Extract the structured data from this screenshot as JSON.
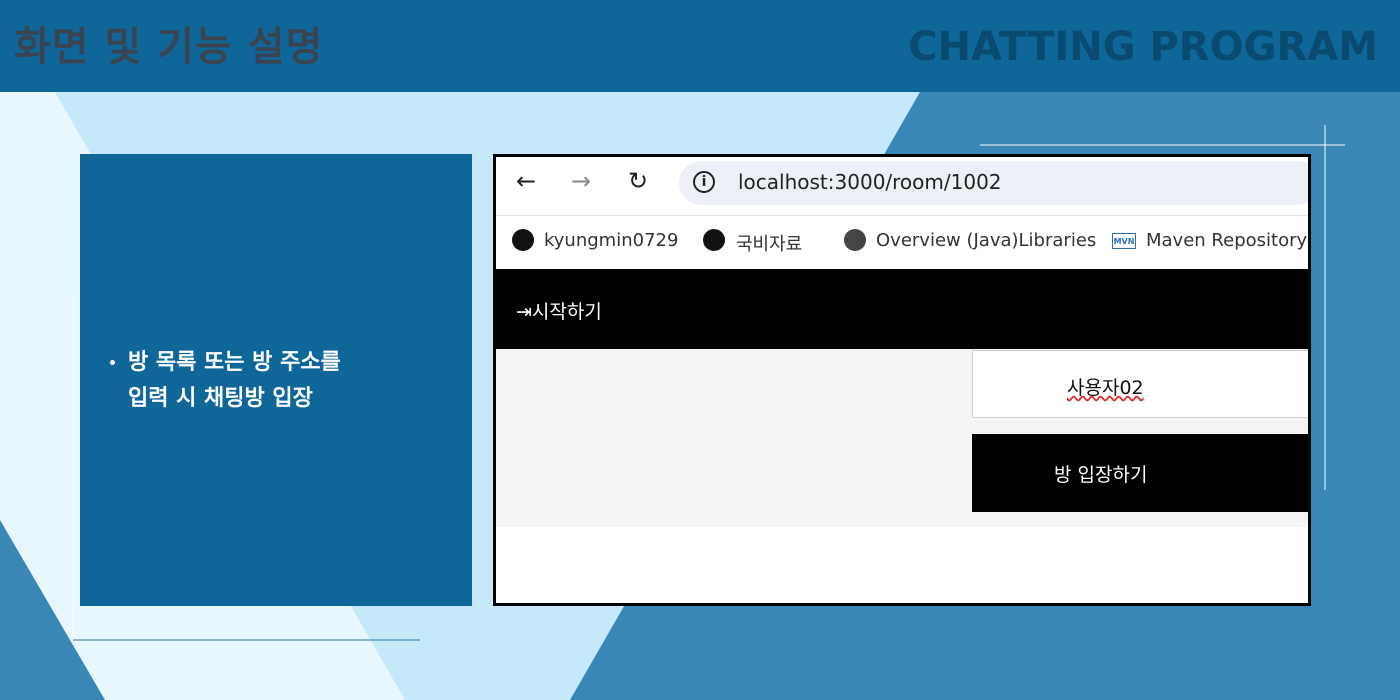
{
  "slide": {
    "title": "화면 및 기능 설명",
    "brand": "CHATTING PROGRAM"
  },
  "description": {
    "line1": "방 목록 또는 방 주소를",
    "line2": "입력 시 채팅방 입장"
  },
  "browser": {
    "back_icon": "back-arrow-icon",
    "forward_icon": "forward-arrow-icon",
    "reload_icon": "reload-icon",
    "url": "localhost:3000/room/1002",
    "bookmarks": [
      {
        "label": "kyungmin0729",
        "icon": "github-icon"
      },
      {
        "label": "국비자료",
        "icon": "github-icon"
      },
      {
        "label": "Overview (Java)Libraries",
        "icon": "globe-icon"
      },
      {
        "label": "Maven Repository",
        "icon": "mvn-icon"
      }
    ]
  },
  "app": {
    "start_label": "시작하기",
    "username_value": "사용자02",
    "enter_button_label": "방 입장하기"
  },
  "colors": {
    "header_bg": "#0e6699",
    "panel_bg": "#0e6699",
    "light_blue": "#c5e8fb",
    "mid_blue": "#3a86b6"
  }
}
